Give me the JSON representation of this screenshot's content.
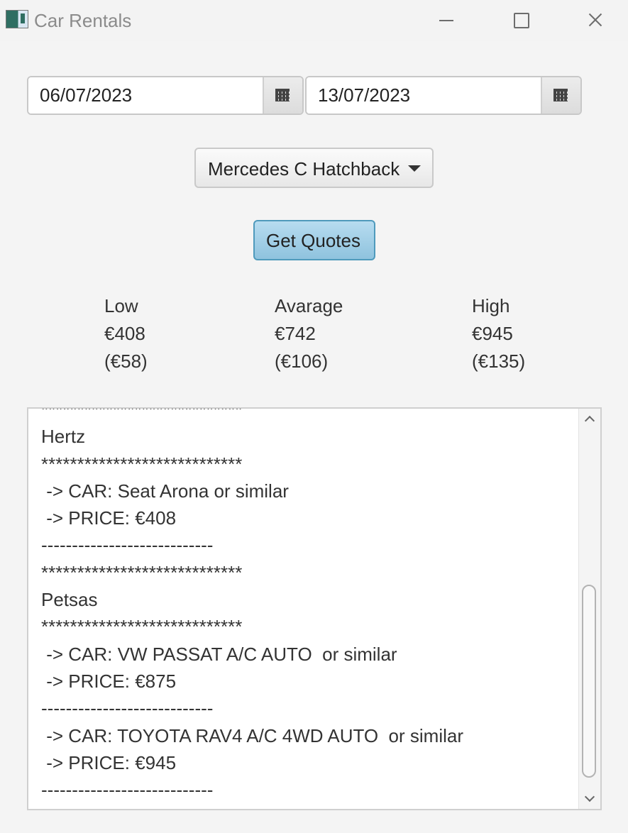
{
  "window": {
    "title": "Car Rentals"
  },
  "dates": {
    "pickup": "06/07/2023",
    "dropoff": "13/07/2023"
  },
  "vehicle_select": {
    "selected": "Mercedes C Hatchback"
  },
  "actions": {
    "get_quotes": "Get Quotes"
  },
  "stats": {
    "low": {
      "label": "Low",
      "total": "€408",
      "daily": "(€58)"
    },
    "average": {
      "label": "Avarage",
      "total": "€742",
      "daily": "(€106)"
    },
    "high": {
      "label": "High",
      "total": "€945",
      "daily": "(€135)"
    }
  },
  "results_text": "****************************\nHertz\n****************************\n -> CAR: Seat Arona or similar\n -> PRICE: €408\n----------------------------\n****************************\nPetsas\n****************************\n -> CAR: VW PASSAT A/C AUTO  or similar\n -> PRICE: €875\n----------------------------\n -> CAR: TOYOTA RAV4 A/C 4WD AUTO  or similar\n -> PRICE: €945\n----------------------------"
}
